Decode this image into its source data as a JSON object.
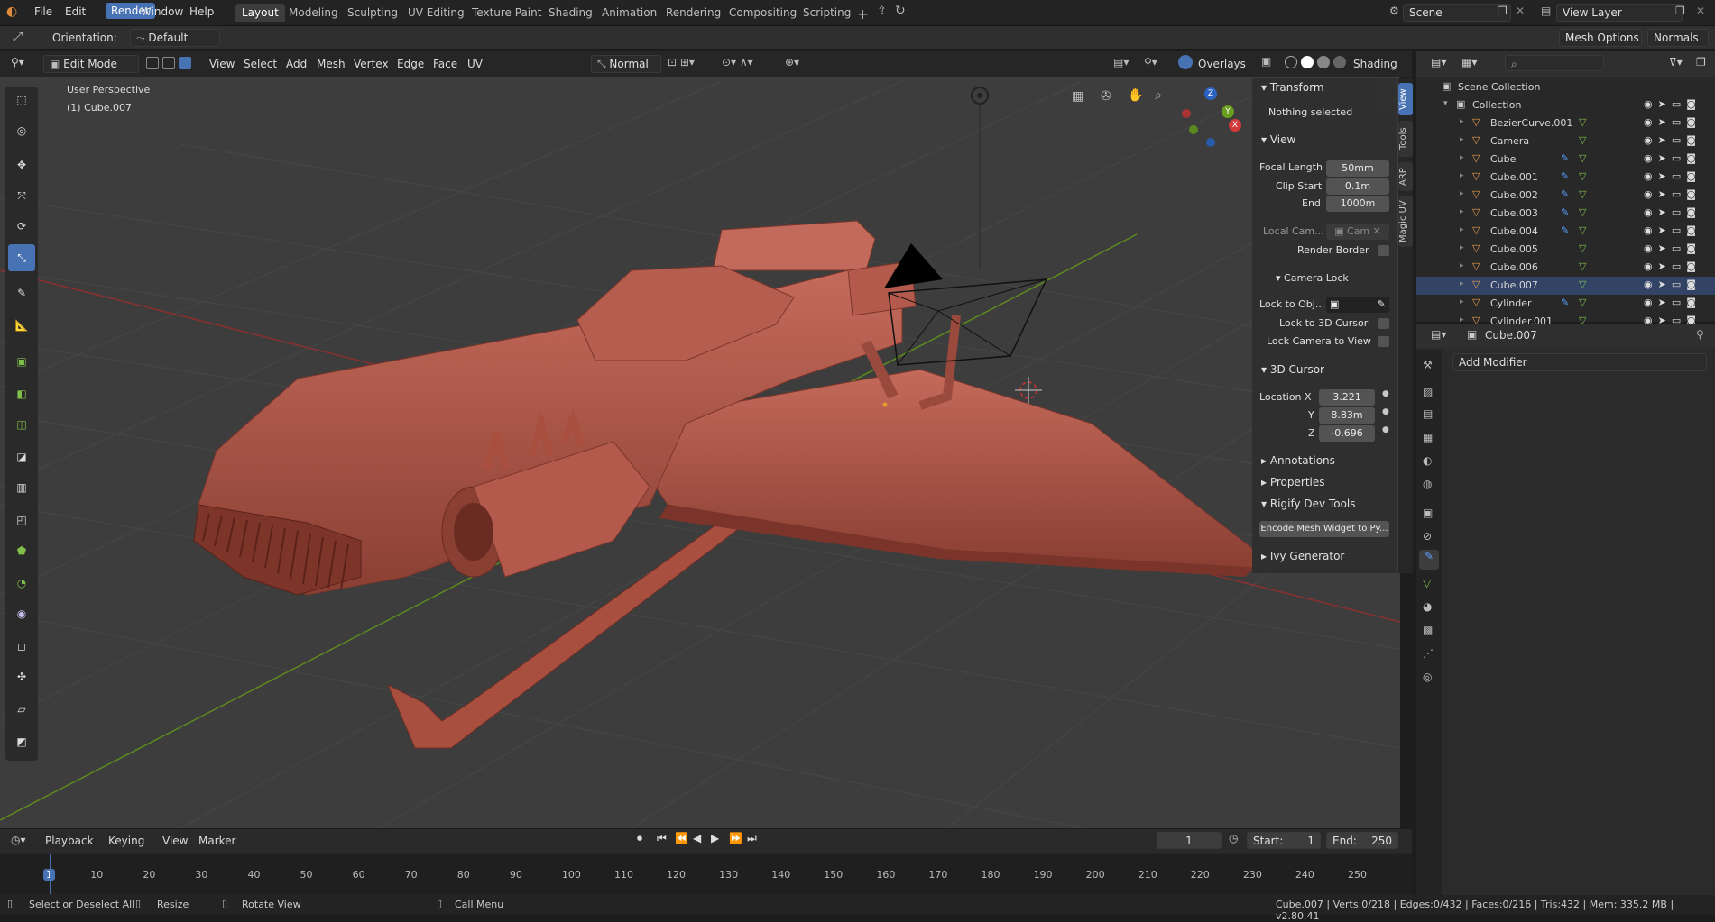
{
  "topbar": {
    "menus": [
      "File",
      "Edit",
      "Render",
      "Window",
      "Help"
    ],
    "workspaces": [
      "Layout",
      "Modeling",
      "Sculpting",
      "UV Editing",
      "Texture Paint",
      "Shading",
      "Animation",
      "Rendering",
      "Compositing",
      "Scripting"
    ],
    "scene": "Scene",
    "view_layer": "View Layer"
  },
  "toolheader": {
    "orientation_label": "Orientation:",
    "orientation_value": "Default",
    "mesh_options": "Mesh Options",
    "normals": "Normals"
  },
  "viewport_header": {
    "mode": "Edit Mode",
    "menus": [
      "View",
      "Select",
      "Add",
      "Mesh",
      "Vertex",
      "Edge",
      "Face",
      "UV"
    ],
    "pivot": "Normal",
    "overlays": "Overlays",
    "shading": "Shading"
  },
  "viewport": {
    "perspective": "User Perspective",
    "object": "(1) Cube.007"
  },
  "npanel": {
    "transform": "Transform",
    "nothing_selected": "Nothing selected",
    "view": "View",
    "focal_length_label": "Focal Length",
    "focal_length": "50mm",
    "clip_start_label": "Clip Start",
    "clip_start": "0.1m",
    "end_label": "End",
    "clip_end": "1000m",
    "local_cam_label": "Local Cam...",
    "local_cam_value": "Cam",
    "render_border": "Render Border",
    "camera_lock": "Camera Lock",
    "lock_to_obj": "Lock to Obj...",
    "lock_to_cursor": "Lock to 3D Cursor",
    "lock_camera": "Lock Camera to View",
    "cursor": "3D Cursor",
    "loc_x_label": "Location X",
    "loc_x": "3.221",
    "loc_y_label": "Y",
    "loc_y": "8.83m",
    "loc_z_label": "Z",
    "loc_z": "-0.696",
    "annotations": "Annotations",
    "properties": "Properties",
    "rigify": "Rigify Dev Tools",
    "encode": "Encode Mesh Widget to Py...",
    "ivy": "Ivy Generator",
    "tabs": [
      "View",
      "Tools",
      "ARP",
      "Magic UV"
    ]
  },
  "outliner": {
    "scene_collection": "Scene Collection",
    "collection": "Collection",
    "items": [
      "BezierCurve.001",
      "Camera",
      "Cube",
      "Cube.001",
      "Cube.002",
      "Cube.003",
      "Cube.004",
      "Cube.005",
      "Cube.006",
      "Cube.007",
      "Cylinder",
      "Cylinder.001"
    ]
  },
  "properties": {
    "object": "Cube.007",
    "add_modifier": "Add Modifier"
  },
  "timeline": {
    "menus": [
      "Playback",
      "Keying",
      "View",
      "Marker"
    ],
    "frame": "1",
    "start_label": "Start:",
    "start": "1",
    "end_label": "End:",
    "end": "250",
    "ticks": [
      "1",
      "10",
      "20",
      "30",
      "40",
      "50",
      "60",
      "70",
      "80",
      "90",
      "100",
      "110",
      "120",
      "130",
      "140",
      "150",
      "160",
      "170",
      "180",
      "190",
      "200",
      "210",
      "220",
      "230",
      "240",
      "250"
    ]
  },
  "status": {
    "select": "Select or Deselect All",
    "resize": "Resize",
    "rotate": "Rotate View",
    "call_menu": "Call Menu",
    "stats": "Cube.007 | Verts:0/218 | Edges:0/432 | Faces:0/216 | Tris:432 | Mem: 335.2 MB | v2.80.41"
  }
}
